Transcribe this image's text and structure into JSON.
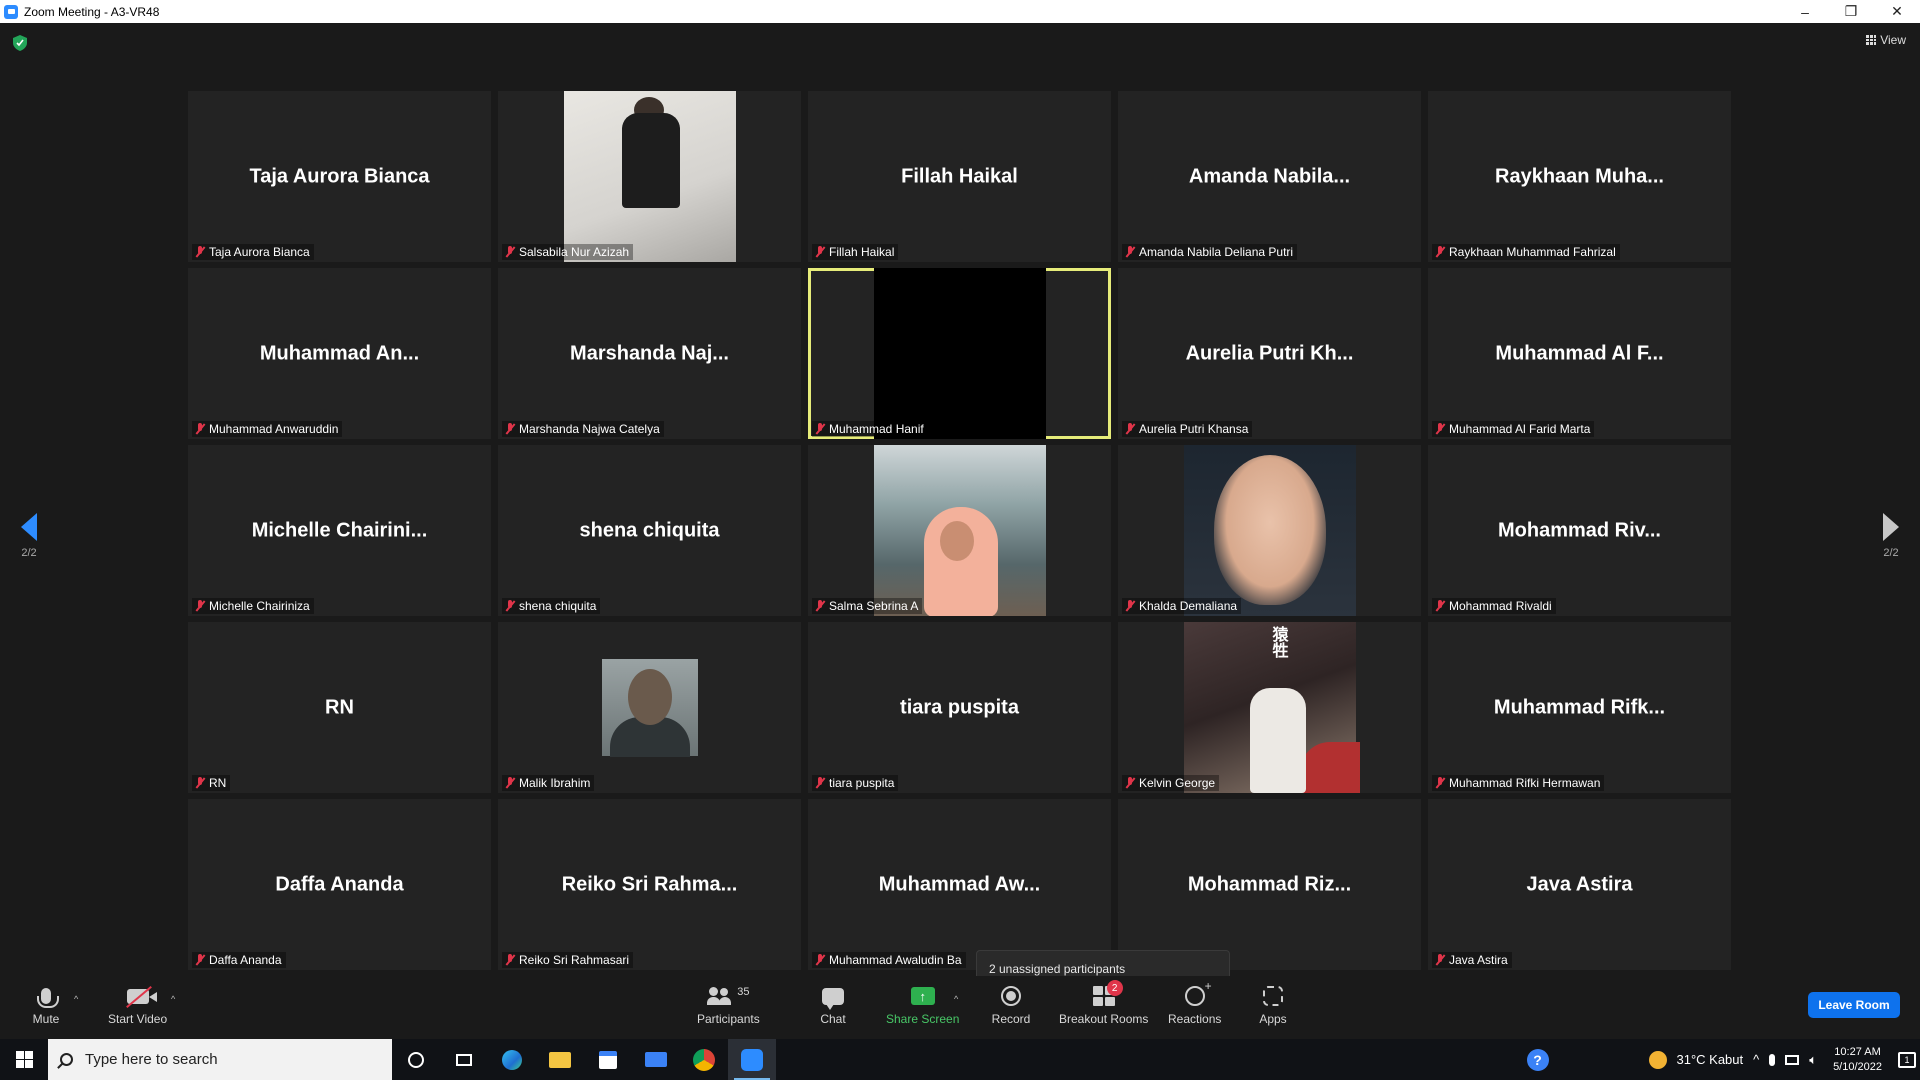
{
  "window": {
    "title": "Zoom Meeting - A3-VR48",
    "minimize": "–",
    "restore": "❐",
    "close": "✕"
  },
  "view_button": "View",
  "pager": {
    "left_page": "2/2",
    "right_page": "2/2"
  },
  "participants": [
    {
      "big": "Taja Aurora Bianca",
      "label": "Taja Aurora Bianca"
    },
    {
      "big": "",
      "label": "Salsabila Nur Azizah",
      "video": "polaroid"
    },
    {
      "big": "Fillah Haikal",
      "label": "Fillah Haikal"
    },
    {
      "big": "Amanda  Nabila...",
      "label": "Amanda Nabila Deliana Putri"
    },
    {
      "big": "Raykhaan  Muha...",
      "label": "Raykhaan Muhammad Fahrizal"
    },
    {
      "big": "Muhammad  An...",
      "label": "Muhammad Anwaruddin"
    },
    {
      "big": "Marshanda  Naj...",
      "label": "Marshanda Najwa Catelya"
    },
    {
      "big": "",
      "label": "Muhammad Hanif",
      "video": "black",
      "active": true
    },
    {
      "big": "Aurelia Putri Kh...",
      "label": "Aurelia Putri Khansa"
    },
    {
      "big": "Muhammad Al F...",
      "label": "Muhammad Al Farid Marta"
    },
    {
      "big": "Michelle  Chairini...",
      "label": "Michelle Chairiniza"
    },
    {
      "big": "shena chiquita",
      "label": "shena chiquita"
    },
    {
      "big": "",
      "label": "Salma Sebrina A",
      "video": "cafe"
    },
    {
      "big": "",
      "label": "Khalda Demaliana",
      "video": "selfie"
    },
    {
      "big": "Mohammad  Riv...",
      "label": "Mohammad Rivaldi"
    },
    {
      "big": "RN",
      "label": "RN"
    },
    {
      "big": "",
      "label": "Malik Ibrahim",
      "video": "portrait"
    },
    {
      "big": "tiara puspita",
      "label": "tiara puspita"
    },
    {
      "big": "",
      "label": "Kelvin George",
      "video": "anime"
    },
    {
      "big": "Muhammad  Rifk...",
      "label": "Muhammad Rifki Hermawan"
    },
    {
      "big": "Daffa Ananda",
      "label": "Daffa Ananda"
    },
    {
      "big": "Reiko  Sri  Rahma...",
      "label": "Reiko Sri Rahmasari"
    },
    {
      "big": "Muhammad  Aw...",
      "label": "Muhammad Awaludin Ba"
    },
    {
      "big": "Mohammad  Riz...",
      "label": "ki Ramdhani"
    },
    {
      "big": "Java Astira",
      "label": "Java Astira"
    }
  ],
  "anime_kanji": "猿牲",
  "tooltip": "2 unassigned participants",
  "toolbar": {
    "mute": "Mute",
    "start_video": "Start Video",
    "participants": "Participants",
    "participant_count": "35",
    "chat": "Chat",
    "share_screen": "Share Screen",
    "share_arrow": "↑",
    "record": "Record",
    "breakout_rooms": "Breakout Rooms",
    "breakout_badge": "2",
    "reactions": "Reactions",
    "apps": "Apps",
    "leave": "Leave Room",
    "caret": "^"
  },
  "taskbar": {
    "search_placeholder": "Type here to search",
    "weather": "31°C  Kabut",
    "time": "10:27 AM",
    "date": "5/10/2022",
    "help": "?",
    "tray_up": "^",
    "notifications": "1"
  },
  "colors": {
    "accent": "#2d8cff",
    "active_speaker": "#e6ec7a",
    "muted": "#e0354a",
    "share": "#2eb04f",
    "leave": "#0e72ed"
  }
}
